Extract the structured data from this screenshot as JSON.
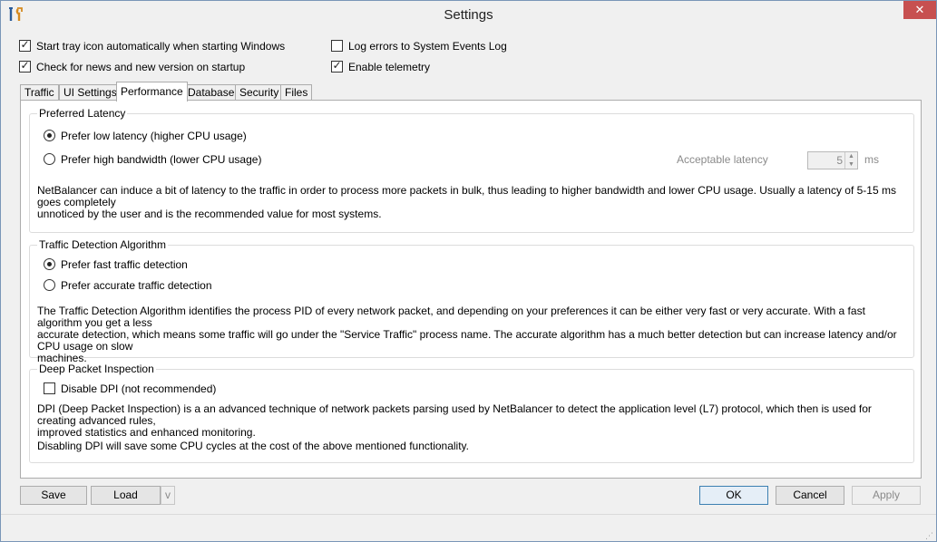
{
  "window": {
    "title": "Settings",
    "close_glyph": "✕"
  },
  "options": {
    "start_tray": {
      "label": "Start tray icon automatically when starting Windows",
      "checked": true
    },
    "check_news": {
      "label": "Check for news and new version on startup",
      "checked": true
    },
    "log_errors": {
      "label": "Log errors to System Events Log",
      "checked": false
    },
    "telemetry": {
      "label": "Enable telemetry",
      "checked": true
    }
  },
  "tabs": [
    {
      "label": "Traffic"
    },
    {
      "label": "UI Settings"
    },
    {
      "label": "Performance",
      "active": true
    },
    {
      "label": "Database"
    },
    {
      "label": "Security"
    },
    {
      "label": "Files"
    }
  ],
  "latency": {
    "legend": "Preferred Latency",
    "option_low": "Prefer low latency (higher CPU usage)",
    "option_high": "Prefer high bandwidth (lower CPU usage)",
    "selected": "low",
    "acceptable_label": "Acceptable latency",
    "acceptable_value": "5",
    "unit": "ms",
    "description_1": "NetBalancer can induce a bit of latency to the traffic in order to process more packets in bulk, thus leading to higher bandwidth and lower CPU usage. Usually a latency of 5-15 ms goes completely",
    "description_2": "unnoticed by the user and is the recommended value for most systems."
  },
  "detection": {
    "legend": "Traffic Detection Algorithm",
    "option_fast": "Prefer fast traffic detection",
    "option_accurate": "Prefer accurate traffic detection",
    "selected": "fast",
    "description_1": "The Traffic Detection Algorithm identifies the process PID of every network packet, and depending on your preferences it can be either very fast or very accurate. With a fast algorithm you get a less",
    "description_2": "accurate detection, which means some traffic will go under the \"Service Traffic\" process name. The accurate algorithm has a much better detection but can increase latency and/or CPU usage on slow",
    "description_3": "machines."
  },
  "dpi": {
    "legend": "Deep Packet Inspection",
    "disable_label": "Disable DPI (not recommended)",
    "disable_checked": false,
    "description_1": "DPI (Deep Packet Inspection) is a an advanced technique of network packets parsing used by NetBalancer to detect the application level (L7) protocol, which then is used for creating advanced rules,",
    "description_2": "improved statistics and enhanced monitoring.",
    "description_3": "Disabling DPI will save some CPU cycles at the cost of the above mentioned functionality."
  },
  "buttons": {
    "save": "Save",
    "load": "Load",
    "load_more": "v",
    "ok": "OK",
    "cancel": "Cancel",
    "apply": "Apply"
  }
}
